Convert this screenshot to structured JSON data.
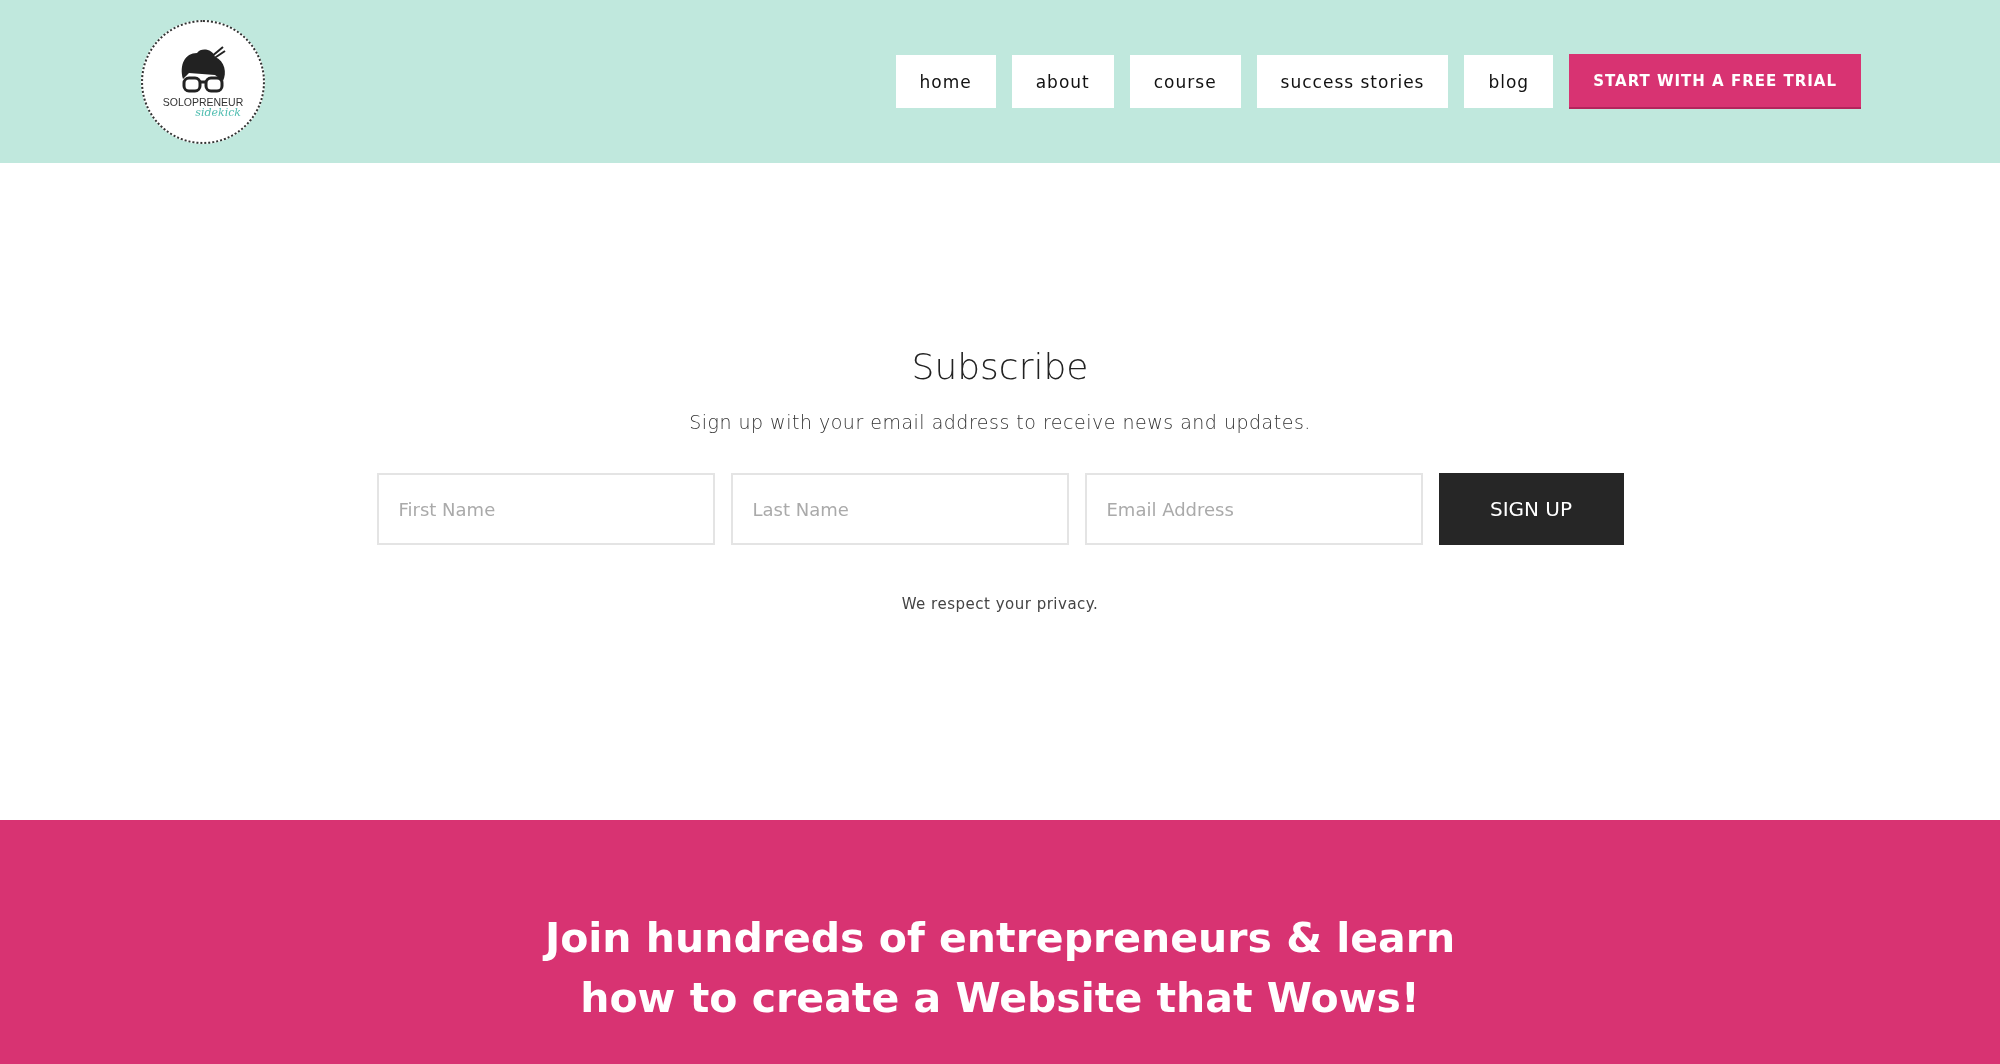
{
  "header": {
    "logo": {
      "wordmark": "SOLOPRENEUR",
      "tagline": "sidekick"
    },
    "nav": [
      {
        "label": "home",
        "kind": "link"
      },
      {
        "label": "about",
        "kind": "link"
      },
      {
        "label": "course",
        "kind": "link"
      },
      {
        "label": "success stories",
        "kind": "link"
      },
      {
        "label": "blog",
        "kind": "link"
      },
      {
        "label": "START WITH A FREE TRIAL",
        "kind": "cta"
      }
    ]
  },
  "subscribe": {
    "title": "Subscribe",
    "description": "Sign up with your email address to receive news and updates.",
    "fields": [
      {
        "placeholder": "First Name"
      },
      {
        "placeholder": "Last Name"
      },
      {
        "placeholder": "Email Address"
      }
    ],
    "button": "SIGN UP",
    "note": "We respect your privacy."
  },
  "banner": {
    "lines": [
      "Join hundreds of entrepreneurs & learn",
      "how to create a Website that Wows!"
    ]
  }
}
